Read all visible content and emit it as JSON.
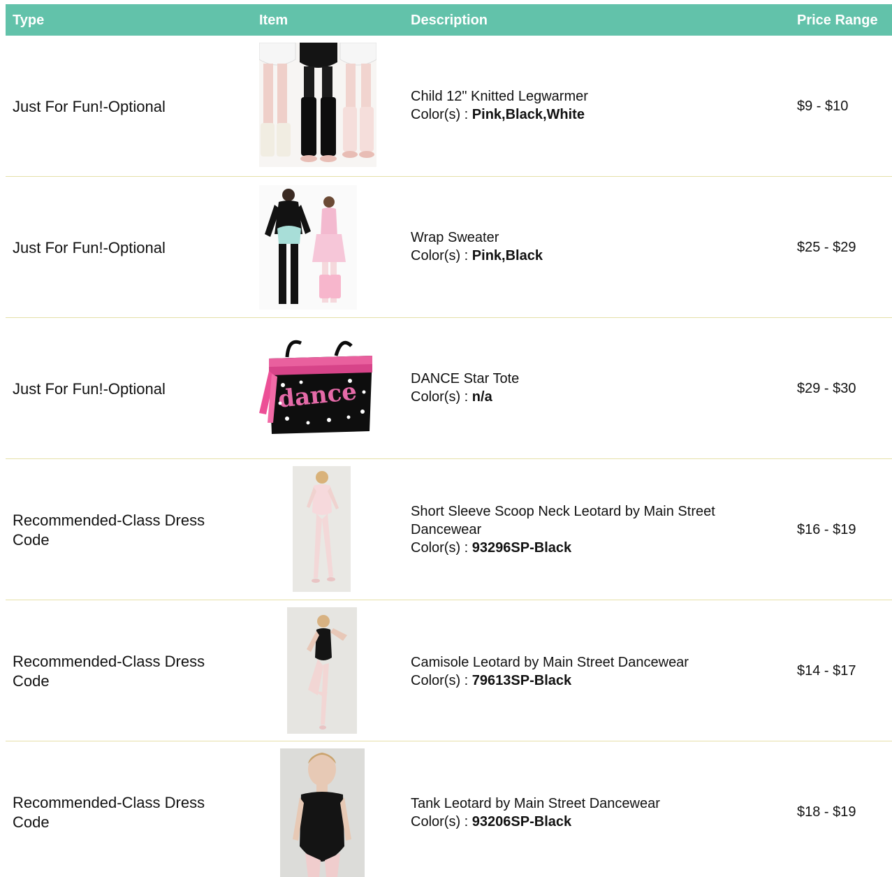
{
  "table": {
    "headers": {
      "type": "Type",
      "item": "Item",
      "description": "Description",
      "price": "Price Range"
    },
    "colors_label": "Color(s) : ",
    "rows": [
      {
        "type": "Just For Fun!-Optional",
        "name": "Child 12\" Knitted Legwarmer",
        "colors": "Pink,Black,White",
        "price": "$9 - $10",
        "image": "legwarmers-photo"
      },
      {
        "type": "Just For Fun!-Optional",
        "name": "Wrap Sweater",
        "colors": "Pink,Black",
        "price": "$25 - $29",
        "image": "wrap-sweater-photo"
      },
      {
        "type": "Just For Fun!-Optional",
        "name": "DANCE Star Tote",
        "colors": "n/a",
        "price": "$29 - $30",
        "image": "dance-tote-photo"
      },
      {
        "type": "Recommended-Class Dress Code",
        "name": "Short Sleeve Scoop Neck Leotard by Main Street Dancewear",
        "colors": "93296SP-Black",
        "price": "$16 - $19",
        "image": "short-sleeve-leotard-photo"
      },
      {
        "type": "Recommended-Class Dress Code",
        "name": "Camisole Leotard by Main Street Dancewear",
        "colors": "79613SP-Black",
        "price": "$14 - $17",
        "image": "camisole-leotard-photo"
      },
      {
        "type": "Recommended-Class Dress Code",
        "name": "Tank Leotard by Main Street Dancewear",
        "colors": "93206SP-Black",
        "price": "$18 - $19",
        "image": "tank-leotard-photo"
      }
    ]
  },
  "colors": {
    "header_bg": "#62c2aa",
    "header_text": "#ffffff",
    "row_separator": "#e5e0a8"
  }
}
